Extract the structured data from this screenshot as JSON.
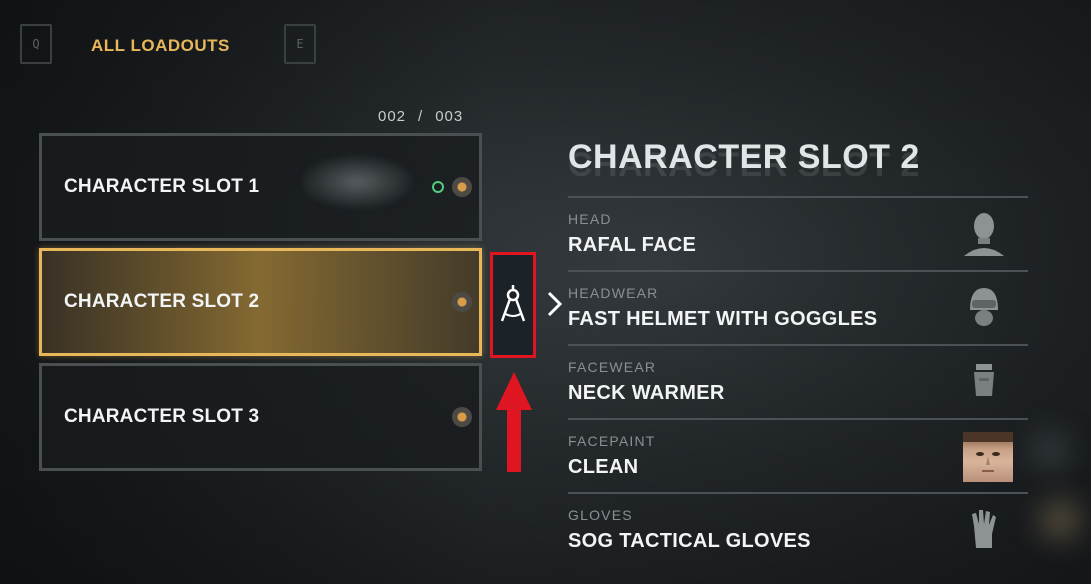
{
  "header": {
    "prev_key": "Q",
    "title": "ALL LOADOUTS",
    "next_key": "E",
    "counter_current": "002",
    "counter_total": "003"
  },
  "slots": [
    {
      "label": "CHARACTER SLOT 1"
    },
    {
      "label": "CHARACTER SLOT 2"
    },
    {
      "label": "CHARACTER SLOT 3"
    }
  ],
  "detail": {
    "title": "CHARACTER SLOT 2",
    "items": [
      {
        "category": "HEAD",
        "name": "RAFAL FACE",
        "icon": "head-icon"
      },
      {
        "category": "HEADWEAR",
        "name": "FAST HELMET WITH GOGGLES",
        "icon": "helmet-icon"
      },
      {
        "category": "FACEWEAR",
        "name": "NECK WARMER",
        "icon": "neck-warmer-icon"
      },
      {
        "category": "FACEPAINT",
        "name": "CLEAN",
        "icon": "face-portrait"
      },
      {
        "category": "GLOVES",
        "name": "SOG TACTICAL GLOVES",
        "icon": "glove-icon"
      }
    ]
  },
  "colors": {
    "accent_gold": "#e8b75a",
    "highlight_red": "#e01522",
    "status_green": "#4fcf7d"
  }
}
